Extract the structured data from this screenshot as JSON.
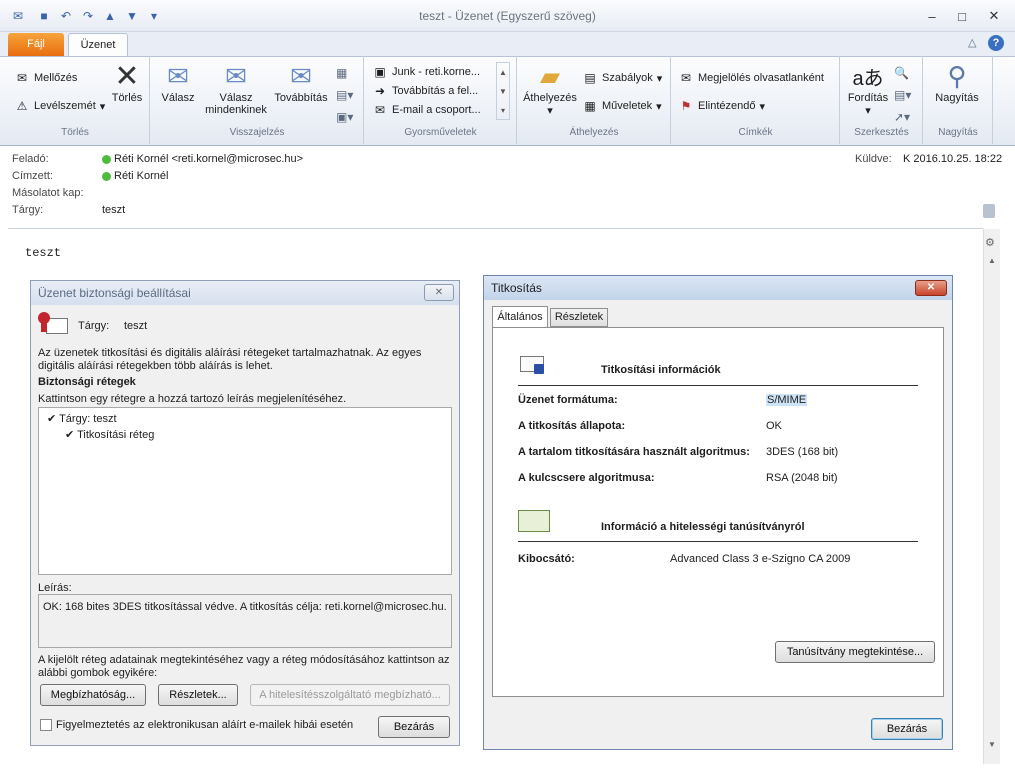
{
  "window": {
    "title": "teszt - Üzenet (Egyszerű szöveg)"
  },
  "tabs": {
    "file": "Fájl",
    "message": "Üzenet"
  },
  "ribbon": {
    "groups": {
      "delete": "Törlés",
      "respond": "Visszajelzés",
      "quick": "Gyorsműveletek",
      "move": "Áthelyezés",
      "tags": "Címkék",
      "edit": "Szerkesztés",
      "zoom": "Nagyítás"
    },
    "ignore": "Mellőzés",
    "junk": "Levélszemét",
    "delete": "Törlés",
    "reply": "Válasz",
    "reply_all_1": "Válasz",
    "reply_all_2": "mindenkinek",
    "forward": "Továbbítás",
    "quick_steps": [
      "Junk - reti.korne...",
      "Továbbítás a fel...",
      "E-mail a csoport..."
    ],
    "move": "Áthelyezés",
    "rules": "Szabályok",
    "actions": "Műveletek",
    "mark_read": "Megjelölés olvasatlanként",
    "follow_up": "Elintézendő",
    "translate": "Fordítás",
    "zoom": "Nagyítás"
  },
  "header": {
    "from_label": "Feladó:",
    "from_value": "Réti Kornél <reti.kornel@microsec.hu>",
    "to_label": "Címzett:",
    "to_value": "Réti Kornél",
    "cc_label": "Másolatot kap:",
    "subject_label": "Tárgy:",
    "subject_value": "teszt",
    "sent_label": "Küldve:",
    "sent_value": "K 2016.10.25. 18:22"
  },
  "body_text": "teszt",
  "sec_dialog": {
    "title": "Üzenet biztonsági beállításai",
    "subject_label": "Tárgy:",
    "subject_value": "teszt",
    "intro_1": "Az üzenetek titkosítási és digitális aláírási rétegeket tartalmazhatnak. Az egyes",
    "intro_2": "digitális aláírási rétegekben több aláírás is lehet.",
    "layers_heading": "Biztonsági rétegek",
    "layers_hint": "Kattintson egy rétegre a hozzá tartozó leírás megjelenítéséhez.",
    "tree": [
      "Tárgy: teszt",
      "Titkosítási réteg"
    ],
    "desc_label": "Leírás:",
    "desc_text": "OK: 168 bites 3DES titkosítással védve. A titkosítás célja: reti.kornel@microsec.hu.",
    "hint_1": "A kijelölt réteg adatainak megtekintéséhez vagy a réteg módosításához kattintson az",
    "hint_2": "alábbi gombok egyikére:",
    "btn_trust": "Megbízhatóság...",
    "btn_details": "Részletek...",
    "btn_ca_trust": "A hitelesítésszolgáltató megbízható...",
    "warn_checkbox": "Figyelmeztetés az elektronikusan aláírt e-mailek hibái esetén",
    "btn_close": "Bezárás"
  },
  "enc_dialog": {
    "title": "Titkosítás",
    "tabs": [
      "Általános",
      "Részletek"
    ],
    "info_heading": "Titkosítási információk",
    "rows": [
      {
        "label": "Üzenet formátuma:",
        "value": "S/MIME"
      },
      {
        "label": "A titkosítás állapota:",
        "value": "OK"
      },
      {
        "label": "A tartalom titkosítására használt algoritmus:",
        "value": "3DES (168 bit)"
      },
      {
        "label": "A kulcscsere algoritmusa:",
        "value": "RSA (2048 bit)"
      }
    ],
    "cert_heading": "Információ a hitelességi tanúsítványról",
    "issuer_label": "Kibocsátó:",
    "issuer_value": "Advanced Class 3 e-Szigno CA 2009",
    "btn_view_cert": "Tanúsítvány megtekintése...",
    "btn_close": "Bezárás"
  },
  "colors": {
    "accent": "#3c7fb1",
    "file_tab": "#e86d0d",
    "selection": "#cde3f7"
  }
}
